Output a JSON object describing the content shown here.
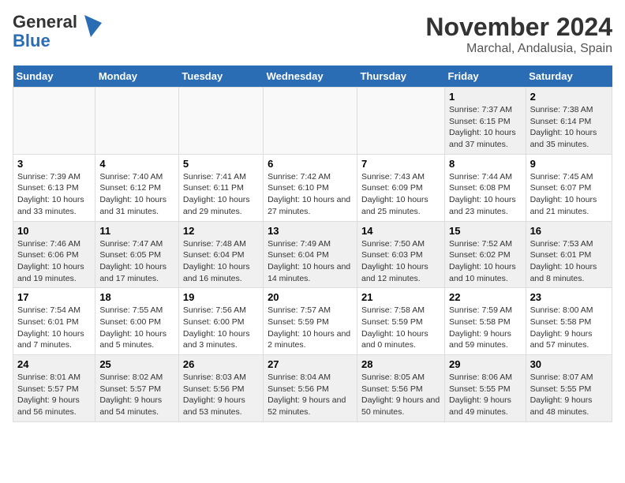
{
  "header": {
    "logo_line1": "General",
    "logo_line2": "Blue",
    "title": "November 2024",
    "subtitle": "Marchal, Andalusia, Spain"
  },
  "calendar": {
    "days_of_week": [
      "Sunday",
      "Monday",
      "Tuesday",
      "Wednesday",
      "Thursday",
      "Friday",
      "Saturday"
    ],
    "weeks": [
      [
        {
          "num": "",
          "info": ""
        },
        {
          "num": "",
          "info": ""
        },
        {
          "num": "",
          "info": ""
        },
        {
          "num": "",
          "info": ""
        },
        {
          "num": "",
          "info": ""
        },
        {
          "num": "1",
          "info": "Sunrise: 7:37 AM\nSunset: 6:15 PM\nDaylight: 10 hours and 37 minutes."
        },
        {
          "num": "2",
          "info": "Sunrise: 7:38 AM\nSunset: 6:14 PM\nDaylight: 10 hours and 35 minutes."
        }
      ],
      [
        {
          "num": "3",
          "info": "Sunrise: 7:39 AM\nSunset: 6:13 PM\nDaylight: 10 hours and 33 minutes."
        },
        {
          "num": "4",
          "info": "Sunrise: 7:40 AM\nSunset: 6:12 PM\nDaylight: 10 hours and 31 minutes."
        },
        {
          "num": "5",
          "info": "Sunrise: 7:41 AM\nSunset: 6:11 PM\nDaylight: 10 hours and 29 minutes."
        },
        {
          "num": "6",
          "info": "Sunrise: 7:42 AM\nSunset: 6:10 PM\nDaylight: 10 hours and 27 minutes."
        },
        {
          "num": "7",
          "info": "Sunrise: 7:43 AM\nSunset: 6:09 PM\nDaylight: 10 hours and 25 minutes."
        },
        {
          "num": "8",
          "info": "Sunrise: 7:44 AM\nSunset: 6:08 PM\nDaylight: 10 hours and 23 minutes."
        },
        {
          "num": "9",
          "info": "Sunrise: 7:45 AM\nSunset: 6:07 PM\nDaylight: 10 hours and 21 minutes."
        }
      ],
      [
        {
          "num": "10",
          "info": "Sunrise: 7:46 AM\nSunset: 6:06 PM\nDaylight: 10 hours and 19 minutes."
        },
        {
          "num": "11",
          "info": "Sunrise: 7:47 AM\nSunset: 6:05 PM\nDaylight: 10 hours and 17 minutes."
        },
        {
          "num": "12",
          "info": "Sunrise: 7:48 AM\nSunset: 6:04 PM\nDaylight: 10 hours and 16 minutes."
        },
        {
          "num": "13",
          "info": "Sunrise: 7:49 AM\nSunset: 6:04 PM\nDaylight: 10 hours and 14 minutes."
        },
        {
          "num": "14",
          "info": "Sunrise: 7:50 AM\nSunset: 6:03 PM\nDaylight: 10 hours and 12 minutes."
        },
        {
          "num": "15",
          "info": "Sunrise: 7:52 AM\nSunset: 6:02 PM\nDaylight: 10 hours and 10 minutes."
        },
        {
          "num": "16",
          "info": "Sunrise: 7:53 AM\nSunset: 6:01 PM\nDaylight: 10 hours and 8 minutes."
        }
      ],
      [
        {
          "num": "17",
          "info": "Sunrise: 7:54 AM\nSunset: 6:01 PM\nDaylight: 10 hours and 7 minutes."
        },
        {
          "num": "18",
          "info": "Sunrise: 7:55 AM\nSunset: 6:00 PM\nDaylight: 10 hours and 5 minutes."
        },
        {
          "num": "19",
          "info": "Sunrise: 7:56 AM\nSunset: 6:00 PM\nDaylight: 10 hours and 3 minutes."
        },
        {
          "num": "20",
          "info": "Sunrise: 7:57 AM\nSunset: 5:59 PM\nDaylight: 10 hours and 2 minutes."
        },
        {
          "num": "21",
          "info": "Sunrise: 7:58 AM\nSunset: 5:59 PM\nDaylight: 10 hours and 0 minutes."
        },
        {
          "num": "22",
          "info": "Sunrise: 7:59 AM\nSunset: 5:58 PM\nDaylight: 9 hours and 59 minutes."
        },
        {
          "num": "23",
          "info": "Sunrise: 8:00 AM\nSunset: 5:58 PM\nDaylight: 9 hours and 57 minutes."
        }
      ],
      [
        {
          "num": "24",
          "info": "Sunrise: 8:01 AM\nSunset: 5:57 PM\nDaylight: 9 hours and 56 minutes."
        },
        {
          "num": "25",
          "info": "Sunrise: 8:02 AM\nSunset: 5:57 PM\nDaylight: 9 hours and 54 minutes."
        },
        {
          "num": "26",
          "info": "Sunrise: 8:03 AM\nSunset: 5:56 PM\nDaylight: 9 hours and 53 minutes."
        },
        {
          "num": "27",
          "info": "Sunrise: 8:04 AM\nSunset: 5:56 PM\nDaylight: 9 hours and 52 minutes."
        },
        {
          "num": "28",
          "info": "Sunrise: 8:05 AM\nSunset: 5:56 PM\nDaylight: 9 hours and 50 minutes."
        },
        {
          "num": "29",
          "info": "Sunrise: 8:06 AM\nSunset: 5:55 PM\nDaylight: 9 hours and 49 minutes."
        },
        {
          "num": "30",
          "info": "Sunrise: 8:07 AM\nSunset: 5:55 PM\nDaylight: 9 hours and 48 minutes."
        }
      ]
    ]
  }
}
